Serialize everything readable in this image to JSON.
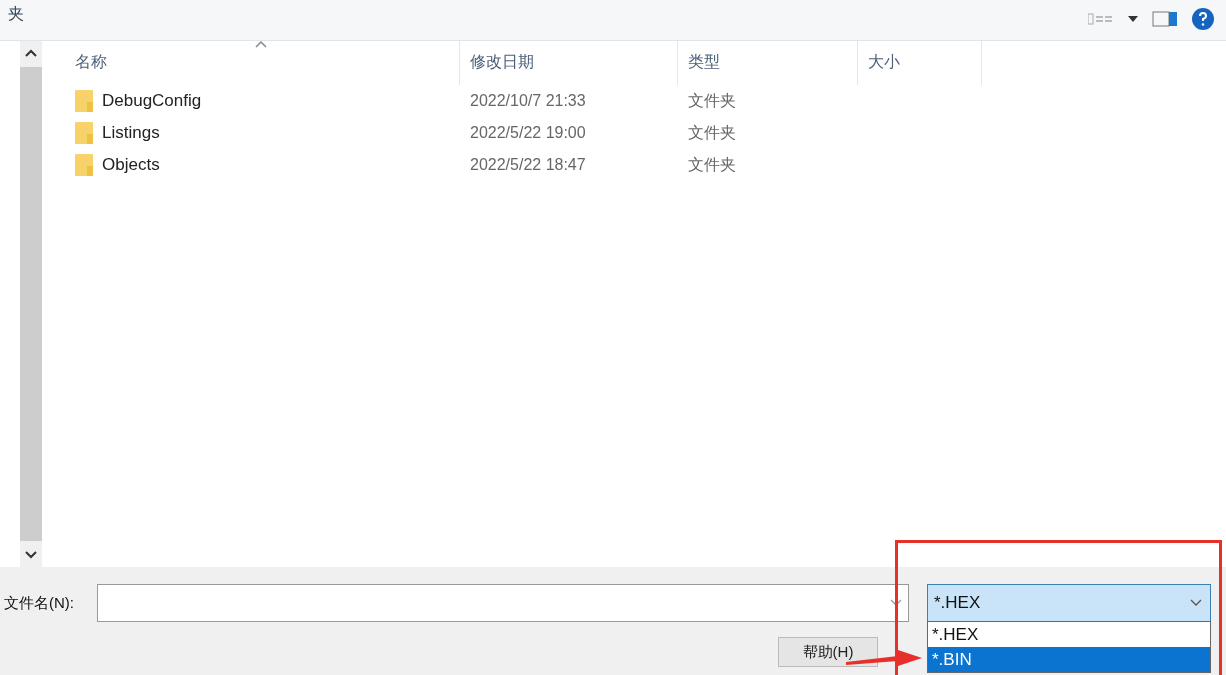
{
  "title_fragment": "夹",
  "table": {
    "columns": [
      "名称",
      "修改日期",
      "类型",
      "大小"
    ],
    "rows": [
      {
        "name": "DebugConfig",
        "modified": "2022/10/7 21:33",
        "type": "文件夹"
      },
      {
        "name": "Listings",
        "modified": "2022/5/22 19:00",
        "type": "文件夹"
      },
      {
        "name": "Objects",
        "modified": "2022/5/22 18:47",
        "type": "文件夹"
      }
    ]
  },
  "filename": {
    "label": "文件名(N):"
  },
  "filetype": {
    "value": "*.HEX",
    "expanded": true,
    "options": [
      {
        "label": "*.HEX",
        "highlighted": false
      },
      {
        "label": "*.BIN",
        "highlighted": true
      }
    ]
  },
  "help_button": "帮助(H)"
}
